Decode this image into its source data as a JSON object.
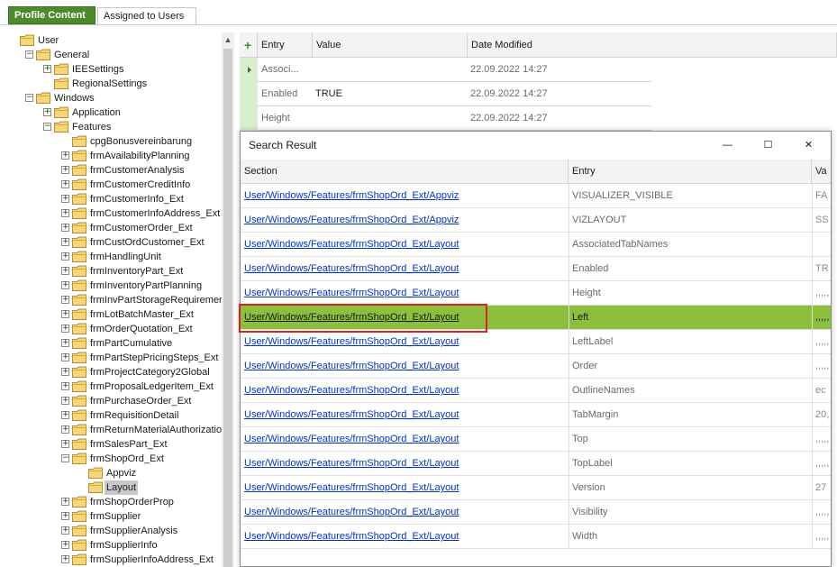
{
  "tabs": {
    "active": "Profile Content",
    "inactive": "Assigned to Users"
  },
  "tree": [
    {
      "label": "User",
      "level": 0,
      "exp": "",
      "selected": false
    },
    {
      "label": "General",
      "level": 1,
      "exp": "−",
      "selected": false
    },
    {
      "label": "IEESettings",
      "level": 2,
      "exp": "+",
      "selected": false
    },
    {
      "label": "RegionalSettings",
      "level": 2,
      "exp": "",
      "selected": false
    },
    {
      "label": "Windows",
      "level": 1,
      "exp": "−",
      "selected": false
    },
    {
      "label": "Application",
      "level": 2,
      "exp": "+",
      "selected": false
    },
    {
      "label": "Features",
      "level": 2,
      "exp": "−",
      "selected": false
    },
    {
      "label": "cpgBonusvereinbarung",
      "level": 3,
      "exp": "",
      "selected": false
    },
    {
      "label": "frmAvailabilityPlanning",
      "level": 3,
      "exp": "+",
      "selected": false
    },
    {
      "label": "frmCustomerAnalysis",
      "level": 3,
      "exp": "+",
      "selected": false
    },
    {
      "label": "frmCustomerCreditInfo",
      "level": 3,
      "exp": "+",
      "selected": false
    },
    {
      "label": "frmCustomerInfo_Ext",
      "level": 3,
      "exp": "+",
      "selected": false
    },
    {
      "label": "frmCustomerInfoAddress_Ext",
      "level": 3,
      "exp": "+",
      "selected": false
    },
    {
      "label": "frmCustomerOrder_Ext",
      "level": 3,
      "exp": "+",
      "selected": false
    },
    {
      "label": "frmCustOrdCustomer_Ext",
      "level": 3,
      "exp": "+",
      "selected": false
    },
    {
      "label": "frmHandlingUnit",
      "level": 3,
      "exp": "+",
      "selected": false
    },
    {
      "label": "frmInventoryPart_Ext",
      "level": 3,
      "exp": "+",
      "selected": false
    },
    {
      "label": "frmInventoryPartPlanning",
      "level": 3,
      "exp": "+",
      "selected": false
    },
    {
      "label": "frmInvPartStorageRequirement",
      "level": 3,
      "exp": "+",
      "selected": false
    },
    {
      "label": "frmLotBatchMaster_Ext",
      "level": 3,
      "exp": "+",
      "selected": false
    },
    {
      "label": "frmOrderQuotation_Ext",
      "level": 3,
      "exp": "+",
      "selected": false
    },
    {
      "label": "frmPartCumulative",
      "level": 3,
      "exp": "+",
      "selected": false
    },
    {
      "label": "frmPartStepPricingSteps_Ext",
      "level": 3,
      "exp": "+",
      "selected": false
    },
    {
      "label": "frmProjectCategory2Global",
      "level": 3,
      "exp": "+",
      "selected": false
    },
    {
      "label": "frmProposalLedgerItem_Ext",
      "level": 3,
      "exp": "+",
      "selected": false
    },
    {
      "label": "frmPurchaseOrder_Ext",
      "level": 3,
      "exp": "+",
      "selected": false
    },
    {
      "label": "frmRequisitionDetail",
      "level": 3,
      "exp": "+",
      "selected": false
    },
    {
      "label": "frmReturnMaterialAuthorization",
      "level": 3,
      "exp": "+",
      "selected": false
    },
    {
      "label": "frmSalesPart_Ext",
      "level": 3,
      "exp": "+",
      "selected": false
    },
    {
      "label": "frmShopOrd_Ext",
      "level": 3,
      "exp": "−",
      "selected": false
    },
    {
      "label": "Appviz",
      "level": 4,
      "exp": "",
      "selected": false
    },
    {
      "label": "Layout",
      "level": 4,
      "exp": "",
      "selected": true
    },
    {
      "label": "frmShopOrderProp",
      "level": 3,
      "exp": "+",
      "selected": false
    },
    {
      "label": "frmSupplier",
      "level": 3,
      "exp": "+",
      "selected": false
    },
    {
      "label": "frmSupplierAnalysis",
      "level": 3,
      "exp": "+",
      "selected": false
    },
    {
      "label": "frmSupplierInfo",
      "level": 3,
      "exp": "+",
      "selected": false
    },
    {
      "label": "frmSupplierInfoAddress_Ext",
      "level": 3,
      "exp": "+",
      "selected": false
    }
  ],
  "grid": {
    "add_glyph": "+",
    "headers": {
      "entry": "Entry",
      "value": "Value",
      "date": "Date Modified"
    },
    "rows": [
      {
        "entry": "Associ...",
        "value": "",
        "date": "22.09.2022 14:27",
        "current": true
      },
      {
        "entry": "Enabled",
        "value": "TRUE",
        "date": "22.09.2022 14:27",
        "current": false
      },
      {
        "entry": "Height",
        "value": "",
        "date": "22.09.2022 14:27",
        "current": false
      }
    ]
  },
  "dialog": {
    "title": "Search Result",
    "minimize_glyph": "—",
    "maximize_glyph": "☐",
    "close_glyph": "✕",
    "headers": {
      "section": "Section",
      "entry": "Entry",
      "value": "Va"
    },
    "rows": [
      {
        "section": "User/Windows/Features/frmShopOrd_Ext/Appviz",
        "entry": "VISUALIZER_VISIBLE",
        "value": "FA",
        "selected": false
      },
      {
        "section": "User/Windows/Features/frmShopOrd_Ext/Appviz",
        "entry": "VIZLAYOUT",
        "value": "SS",
        "selected": false
      },
      {
        "section": "User/Windows/Features/frmShopOrd_Ext/Layout",
        "entry": "AssociatedTabNames",
        "value": "",
        "selected": false
      },
      {
        "section": "User/Windows/Features/frmShopOrd_Ext/Layout",
        "entry": "Enabled",
        "value": "TR",
        "selected": false
      },
      {
        "section": "User/Windows/Features/frmShopOrd_Ext/Layout",
        "entry": "Height",
        "value": ",,,,,",
        "selected": false
      },
      {
        "section": "User/Windows/Features/frmShopOrd_Ext/Layout",
        "entry": "Left",
        "value": ",,,,,",
        "selected": true
      },
      {
        "section": "User/Windows/Features/frmShopOrd_Ext/Layout",
        "entry": "LeftLabel",
        "value": ",,,,,",
        "selected": false
      },
      {
        "section": "User/Windows/Features/frmShopOrd_Ext/Layout",
        "entry": "Order",
        "value": ",,,,,",
        "selected": false
      },
      {
        "section": "User/Windows/Features/frmShopOrd_Ext/Layout",
        "entry": "OutlineNames",
        "value": "ec",
        "selected": false
      },
      {
        "section": "User/Windows/Features/frmShopOrd_Ext/Layout",
        "entry": "TabMargin",
        "value": "20,",
        "selected": false
      },
      {
        "section": "User/Windows/Features/frmShopOrd_Ext/Layout",
        "entry": "Top",
        "value": ",,,,,",
        "selected": false
      },
      {
        "section": "User/Windows/Features/frmShopOrd_Ext/Layout",
        "entry": "TopLabel",
        "value": ",,,,,",
        "selected": false
      },
      {
        "section": "User/Windows/Features/frmShopOrd_Ext/Layout",
        "entry": "Version",
        "value": "27",
        "selected": false
      },
      {
        "section": "User/Windows/Features/frmShopOrd_Ext/Layout",
        "entry": "Visibility",
        "value": ",,,,,",
        "selected": false
      },
      {
        "section": "User/Windows/Features/frmShopOrd_Ext/Layout",
        "entry": "Width",
        "value": ",,,,,",
        "selected": false
      }
    ]
  },
  "colors": {
    "accent_green": "#4c8a2a",
    "selection_green": "#8cbf3b",
    "link_blue": "#0033cc",
    "highlight_red": "#e02020"
  }
}
